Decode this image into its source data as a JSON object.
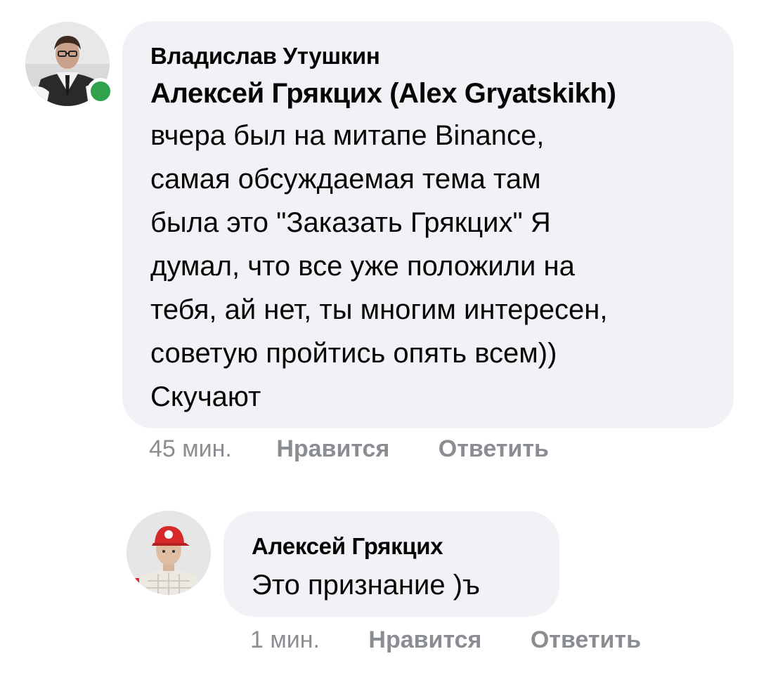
{
  "comments": [
    {
      "author": "Владислав Утушкин",
      "mention": "Алексей Грякцих (Alex Gryatskikh)",
      "lines": [
        "вчера был на митапе Binance,",
        "самая обсуждаемая тема там",
        "была это \"Заказать Грякцих\" Я",
        "думал, что все уже положили на",
        "тебя, ай нет, ты многим интересен,",
        "советую пройтись опять всем))",
        "Скучают"
      ],
      "time": "45 мин.",
      "like_label": "Нравится",
      "reply_label": "Ответить",
      "online": true
    },
    {
      "author": "Алексей Грякцих",
      "text": "Это признание )ъ",
      "time": "1 мин.",
      "like_label": "Нравится",
      "reply_label": "Ответить"
    }
  ],
  "colors": {
    "bubble": "#f0f2f5",
    "meta_text": "#8a8d91",
    "online": "#31a24c",
    "text": "#050505"
  },
  "icons": {
    "first_avatar": "man-in-suit-avatar",
    "second_avatar": "man-in-red-cap-avatar"
  }
}
